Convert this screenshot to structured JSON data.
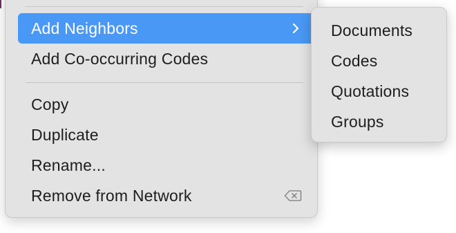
{
  "context_menu": {
    "items": [
      {
        "label": "Add Neighbors",
        "highlighted": true,
        "has_submenu": true
      },
      {
        "label": "Add Co-occurring Codes"
      },
      {
        "label": "Copy"
      },
      {
        "label": "Duplicate"
      },
      {
        "label": "Rename..."
      },
      {
        "label": "Remove from Network",
        "shortcut_icon": "delete-key-icon"
      }
    ]
  },
  "submenu": {
    "items": [
      {
        "label": "Documents"
      },
      {
        "label": "Codes"
      },
      {
        "label": "Quotations"
      },
      {
        "label": "Groups"
      }
    ]
  },
  "colors": {
    "menu_background": "#e3e3e3",
    "highlight": "#4a98f5",
    "separator": "#c4c4c4",
    "text": "#1d1d1d"
  }
}
